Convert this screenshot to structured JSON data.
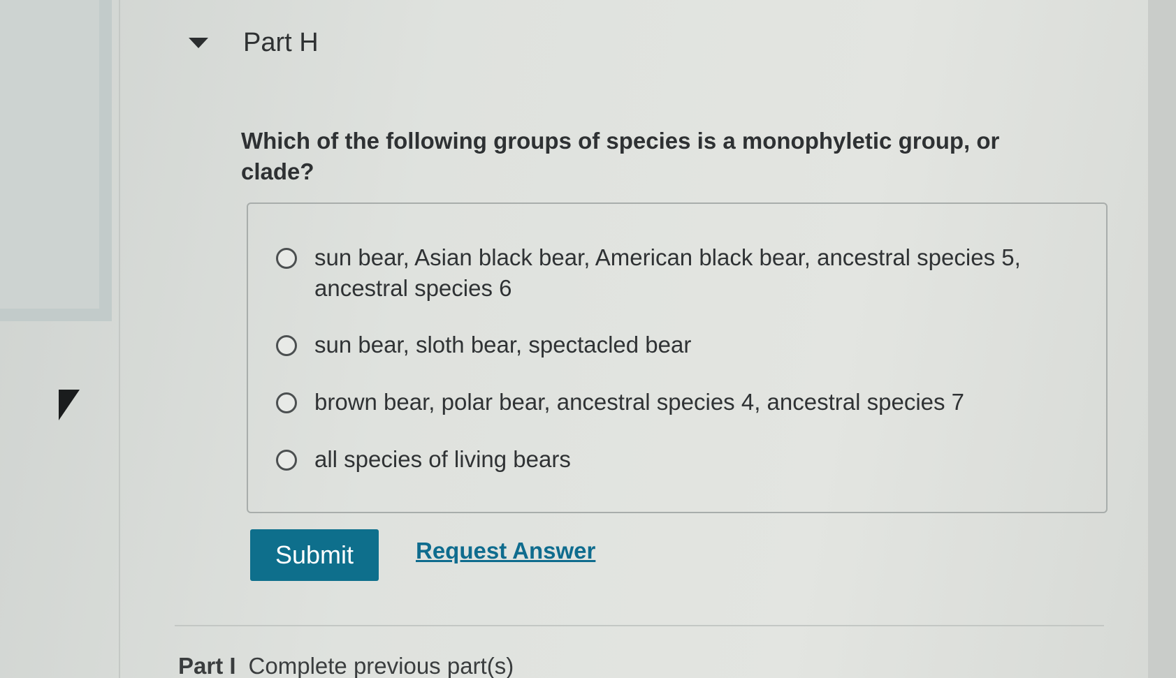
{
  "part": {
    "title": "Part H"
  },
  "question": {
    "text": "Which of the following groups of species is a monophyletic group, or clade?"
  },
  "options": [
    {
      "label": "sun bear, Asian black bear, American black bear, ancestral species 5, ancestral species 6",
      "selected": false
    },
    {
      "label": "sun bear, sloth bear, spectacled bear",
      "selected": false
    },
    {
      "label": "brown bear, polar bear, ancestral species 4, ancestral species 7",
      "selected": false
    },
    {
      "label": "all species of living bears",
      "selected": false
    }
  ],
  "actions": {
    "submit_label": "Submit",
    "request_answer_label": "Request Answer"
  },
  "next_part": {
    "label": "Part I",
    "status": "Complete previous part(s)"
  },
  "colors": {
    "submit_bg": "#0e6f8c",
    "link": "#0f6c8e"
  }
}
